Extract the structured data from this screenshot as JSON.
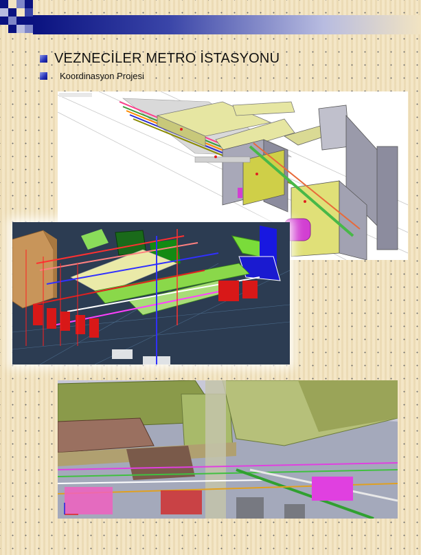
{
  "slide": {
    "title": "VEZNECİLER METRO İSTASYONU",
    "subtitle": "Koordinasyon Projesi"
  },
  "images": [
    {
      "description_icon": "bim-isometric-view-light"
    },
    {
      "description_icon": "bim-mep-model-dark"
    },
    {
      "description_icon": "bim-perspective-duct-view"
    }
  ],
  "colors": {
    "header_dark": "#0a1280",
    "bullet": "#2430b8",
    "background": "#f2e4c2"
  }
}
